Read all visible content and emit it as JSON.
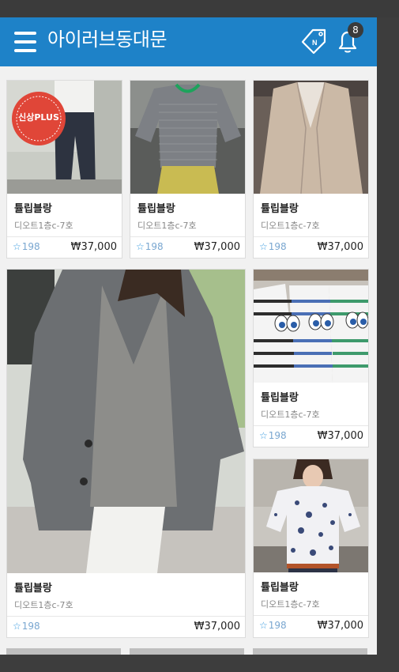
{
  "header": {
    "title": "아이러브동대문",
    "notification_count": "8",
    "tag_icon_letter": "N",
    "color": "#1e82c8"
  },
  "products": [
    {
      "name": "튤립블랑",
      "location": "디오트1층c-7호",
      "likes": "198",
      "price": "₩37,000",
      "image": "wide-pants-with-sticker",
      "sticker_text": "신상PLUS"
    },
    {
      "name": "튤립블랑",
      "location": "디오트1층c-7호",
      "likes": "198",
      "price": "₩37,000",
      "image": "striped-tee-mannequin"
    },
    {
      "name": "튤립블랑",
      "location": "디오트1층c-7호",
      "likes": "198",
      "price": "₩37,000",
      "image": "beige-linen-jacket"
    },
    {
      "name": "튤립블랑",
      "location": "디오트1층c-7호",
      "likes": "198",
      "price": "₩37,000",
      "image": "gray-linen-blazer"
    },
    {
      "name": "튤립블랑",
      "location": "디오트1층c-7호",
      "likes": "198",
      "price": "₩37,000",
      "image": "striped-tees-eyes"
    },
    {
      "name": "튤립블랑",
      "location": "디오트1층c-7호",
      "likes": "198",
      "price": "₩37,000",
      "image": "floral-blouse"
    }
  ]
}
